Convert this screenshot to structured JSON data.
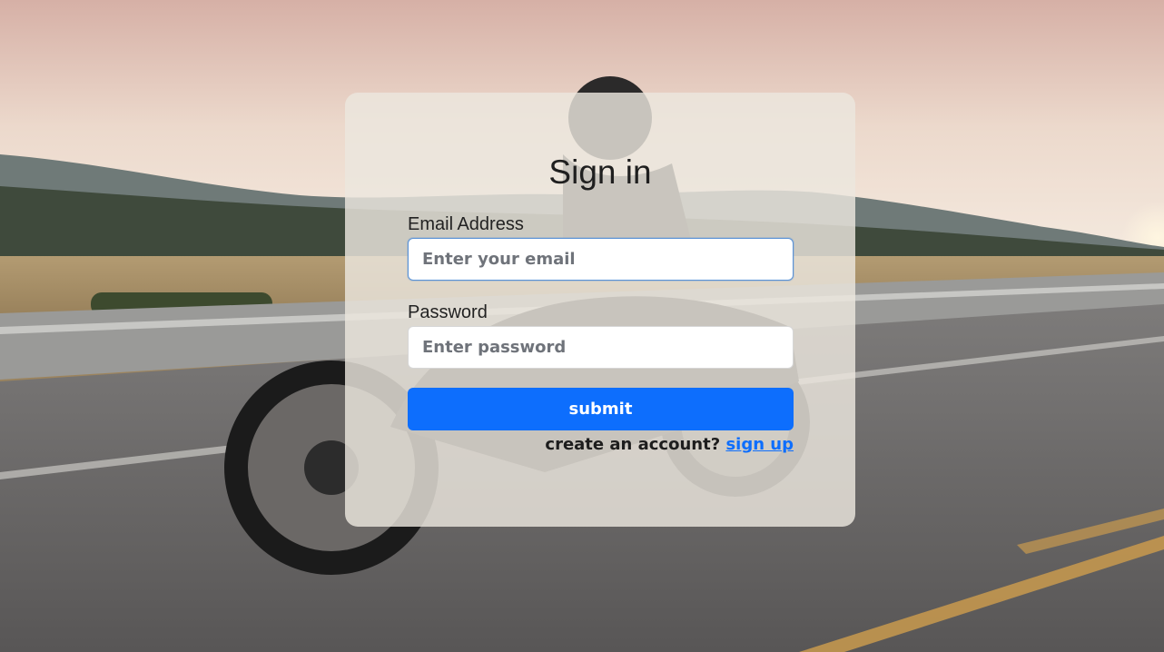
{
  "form": {
    "title": "Sign in",
    "email_label": "Email Address",
    "email_placeholder": "Enter your email",
    "email_value": "",
    "password_label": "Password",
    "password_placeholder": "Enter password",
    "password_value": "",
    "submit_label": "submit",
    "signup_prompt": "create an account?",
    "signup_link": "sign up"
  },
  "colors": {
    "accent": "#0d6efd",
    "card": "#ece6de",
    "focus_border": "#5a92d6"
  },
  "background": {
    "icon": "motorcycle-road-photo"
  }
}
